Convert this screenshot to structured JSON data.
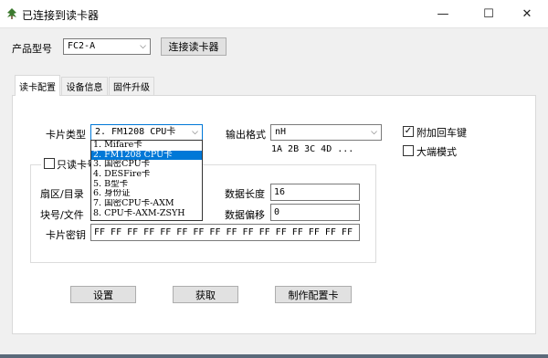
{
  "window": {
    "title": "已连接到读卡器",
    "minimize_glyph": "—",
    "maximize_glyph": "☐",
    "close_glyph": "✕",
    "icon": "app-leaf-icon",
    "icon_color": "#3c7a2e"
  },
  "top": {
    "product_label": "产品型号",
    "product_value": "FC2-A",
    "connect_button": "连接读卡器"
  },
  "tabs": [
    {
      "label": "读卡配置"
    },
    {
      "label": "设备信息"
    },
    {
      "label": "固件升级"
    }
  ],
  "config": {
    "card_type_label": "卡片类型",
    "card_type_value": "2. FM1208 CPU卡",
    "output_format_label": "输出格式",
    "output_format_value": "nH",
    "output_example": "1A 2B 3C 4D ...",
    "append_enter_label": "附加回车键",
    "append_enter_checked": true,
    "big_endian_label": "大端模式",
    "big_endian_checked": false,
    "read_only_label": "只读卡号",
    "read_only_checked": false,
    "sector_label": "扇区/目录",
    "block_label": "块号/文件",
    "data_length_label": "数据长度",
    "data_length_value": "16",
    "data_offset_label": "数据偏移",
    "data_offset_value": "0",
    "card_key_label": "卡片密钥",
    "card_key_value": "FF FF FF FF FF FF FF FF FF FF FF FF FF FF FF FF",
    "set_button": "设置",
    "get_button": "获取",
    "make_card_button": "制作配置卡"
  },
  "card_type_options": [
    "1. Mifare卡",
    "2. FM1208 CPU卡",
    "3. 国密CPU卡",
    "4. DESFire卡",
    "5. B型卡",
    "6. 身份证",
    "7. 国密CPU卡-AXM",
    "8. CPU卡-AXM-ZSYH"
  ],
  "card_type_selected_index": 1,
  "colors": {
    "selection": "#0078d7",
    "button_face": "#e1e1e1"
  }
}
